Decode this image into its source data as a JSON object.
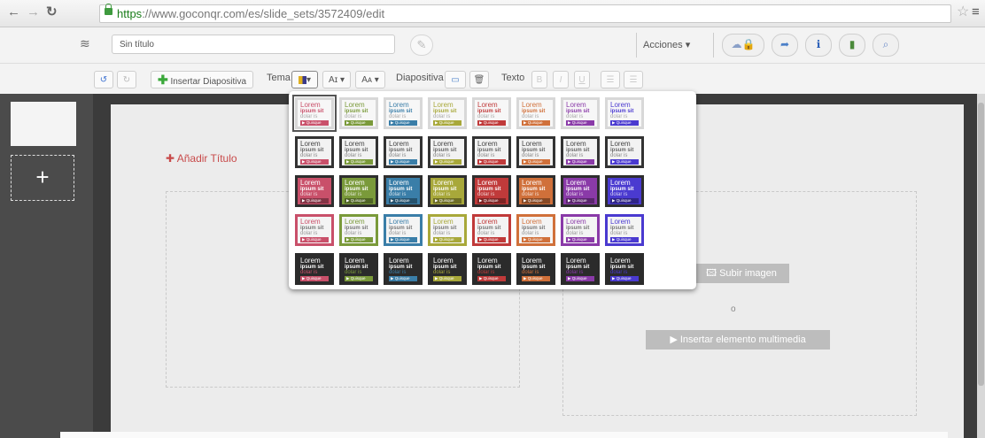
{
  "browser": {
    "url_https": "https",
    "url_rest": "://www.goconqr.com/es/slide_sets/3572409/edit"
  },
  "header": {
    "title_value": "Sin título",
    "actions_label": "Acciones ▾"
  },
  "toolbar": {
    "insert_slide_label": "Insertar Diapositiva",
    "theme_label": "Tema",
    "font_btn_label": "Aɪ ▾",
    "font_size_btn_label": "Aᴀ ▾",
    "slide_label": "Diapositiva",
    "text_label": "Texto"
  },
  "slide": {
    "add_title_label": "✚ Añadir Título",
    "upload_image_label": "Subir imagen",
    "or_label": "o",
    "insert_media_label": "Insertar elemento multimedia"
  },
  "theme_swatch_text": {
    "line1": "Lorem",
    "line2": "ipsum sit",
    "line3": "dolar is",
    "button": "▶ Quisque"
  },
  "theme_palette": {
    "accents": [
      "#c9506a",
      "#7a9a3a",
      "#3a7ea8",
      "#a8a83a",
      "#c03a3a",
      "#d0703a",
      "#8a3aa8",
      "#4a3ad0"
    ],
    "rows": [
      "light-bordered-gray",
      "light-bordered-dark",
      "solid-color",
      "light-color-border",
      "dark"
    ]
  },
  "colors": {
    "accent_red": "#c84a4a",
    "insert_green": "#3aa83a"
  }
}
